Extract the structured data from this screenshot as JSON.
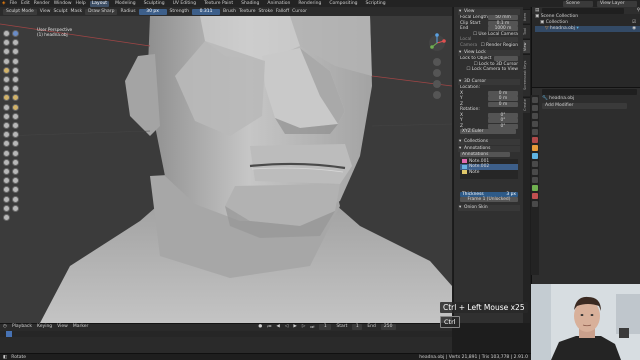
{
  "topbar": {
    "menus": [
      "File",
      "Edit",
      "Render",
      "Window",
      "Help"
    ],
    "workspaces": [
      "Layout",
      "Modeling",
      "Sculpting",
      "UV Editing",
      "Texture Paint",
      "Shading",
      "Animation",
      "Rendering",
      "Compositing",
      "Scripting"
    ],
    "active_workspace": "Layout",
    "scene_label": "Scene",
    "view_layer_label": "View Layer"
  },
  "tool_header": {
    "mode": "Sculpt Mode",
    "view": "View",
    "sculpt": "Sculpt",
    "mask": "Mask",
    "tool": "Draw Sharp",
    "radius_label": "Radius",
    "radius_value": "30 px",
    "strength_label": "Strength",
    "strength_value": "0.311",
    "brush": "Brush",
    "texture": "Texture",
    "stroke": "Stroke",
    "falloff": "Falloff",
    "cursor": "Cursor"
  },
  "viewport": {
    "view_name": "User Perspective",
    "object_name": "(1) headna.obj",
    "overlay_labels": [
      "Options"
    ]
  },
  "npanel": {
    "view_header": "View",
    "focal_length_label": "Focal Length",
    "focal_length_value": "50 mm",
    "clip_start_label": "Clip Start",
    "clip_start_value": "0.1 m",
    "clip_end_label": "End",
    "clip_end_value": "1000 m",
    "use_local_camera": "Use Local Camera",
    "local_camera_label": "Local Camera",
    "render_region": "Render Region",
    "view_lock_header": "View Lock",
    "lock_to_object_label": "Lock to Object",
    "lock_to_3d_cursor": "Lock to 3D Cursor",
    "lock_camera_to_view": "Lock Camera to View",
    "cursor_header": "3D Cursor",
    "location_label": "Location:",
    "location": [
      {
        "axis": "X",
        "value": "0 m"
      },
      {
        "axis": "Y",
        "value": "0 m"
      },
      {
        "axis": "Z",
        "value": "0 m"
      }
    ],
    "rotation_label": "Rotation:",
    "rotation": [
      {
        "axis": "X",
        "value": "0°"
      },
      {
        "axis": "Y",
        "value": "0°"
      },
      {
        "axis": "Z",
        "value": "0°"
      }
    ],
    "rotation_mode": "XYZ Euler",
    "collections_header": "Collections",
    "annotations_header": "Annotations",
    "annotations_name": "Annotations",
    "annotation_layers": [
      {
        "name": "Note.001",
        "color": "#e06ab0"
      },
      {
        "name": "Note.002",
        "color": "#6ab0e0"
      },
      {
        "name": "Note",
        "color": "#e0c86a"
      }
    ],
    "thickness_label": "Thickness",
    "thickness_value": "3 px",
    "frame_label": "Frame 1 (Unlocked)",
    "onion_skin": "Onion Skin",
    "tabs": [
      "Item",
      "Tool",
      "View",
      "Screencast Keys",
      "Create"
    ]
  },
  "outliner": {
    "search_placeholder": "",
    "items": [
      "Scene Collection",
      "Collection",
      "headna.obj"
    ]
  },
  "properties": {
    "object_name": "headna.obj",
    "add_modifier": "Add Modifier"
  },
  "timeline": {
    "menus": [
      "Playback",
      "Keying",
      "View",
      "Marker"
    ],
    "current_frame": "1",
    "start_label": "Start",
    "start_value": "1",
    "end_label": "End",
    "end_value": "250"
  },
  "status_bar": {
    "left": "Rotate",
    "right": "headna.obj | Verts 21,891 | Tris 103,778 | 2.91.0"
  },
  "screencast": {
    "combo": "Ctrl + Left Mouse x25",
    "key": "Ctrl"
  },
  "colors": {
    "accent": "#4772b3",
    "viewport_bg": "#3b3b3b",
    "mesh": "#bdbdbd",
    "panel_bg": "#303030"
  }
}
